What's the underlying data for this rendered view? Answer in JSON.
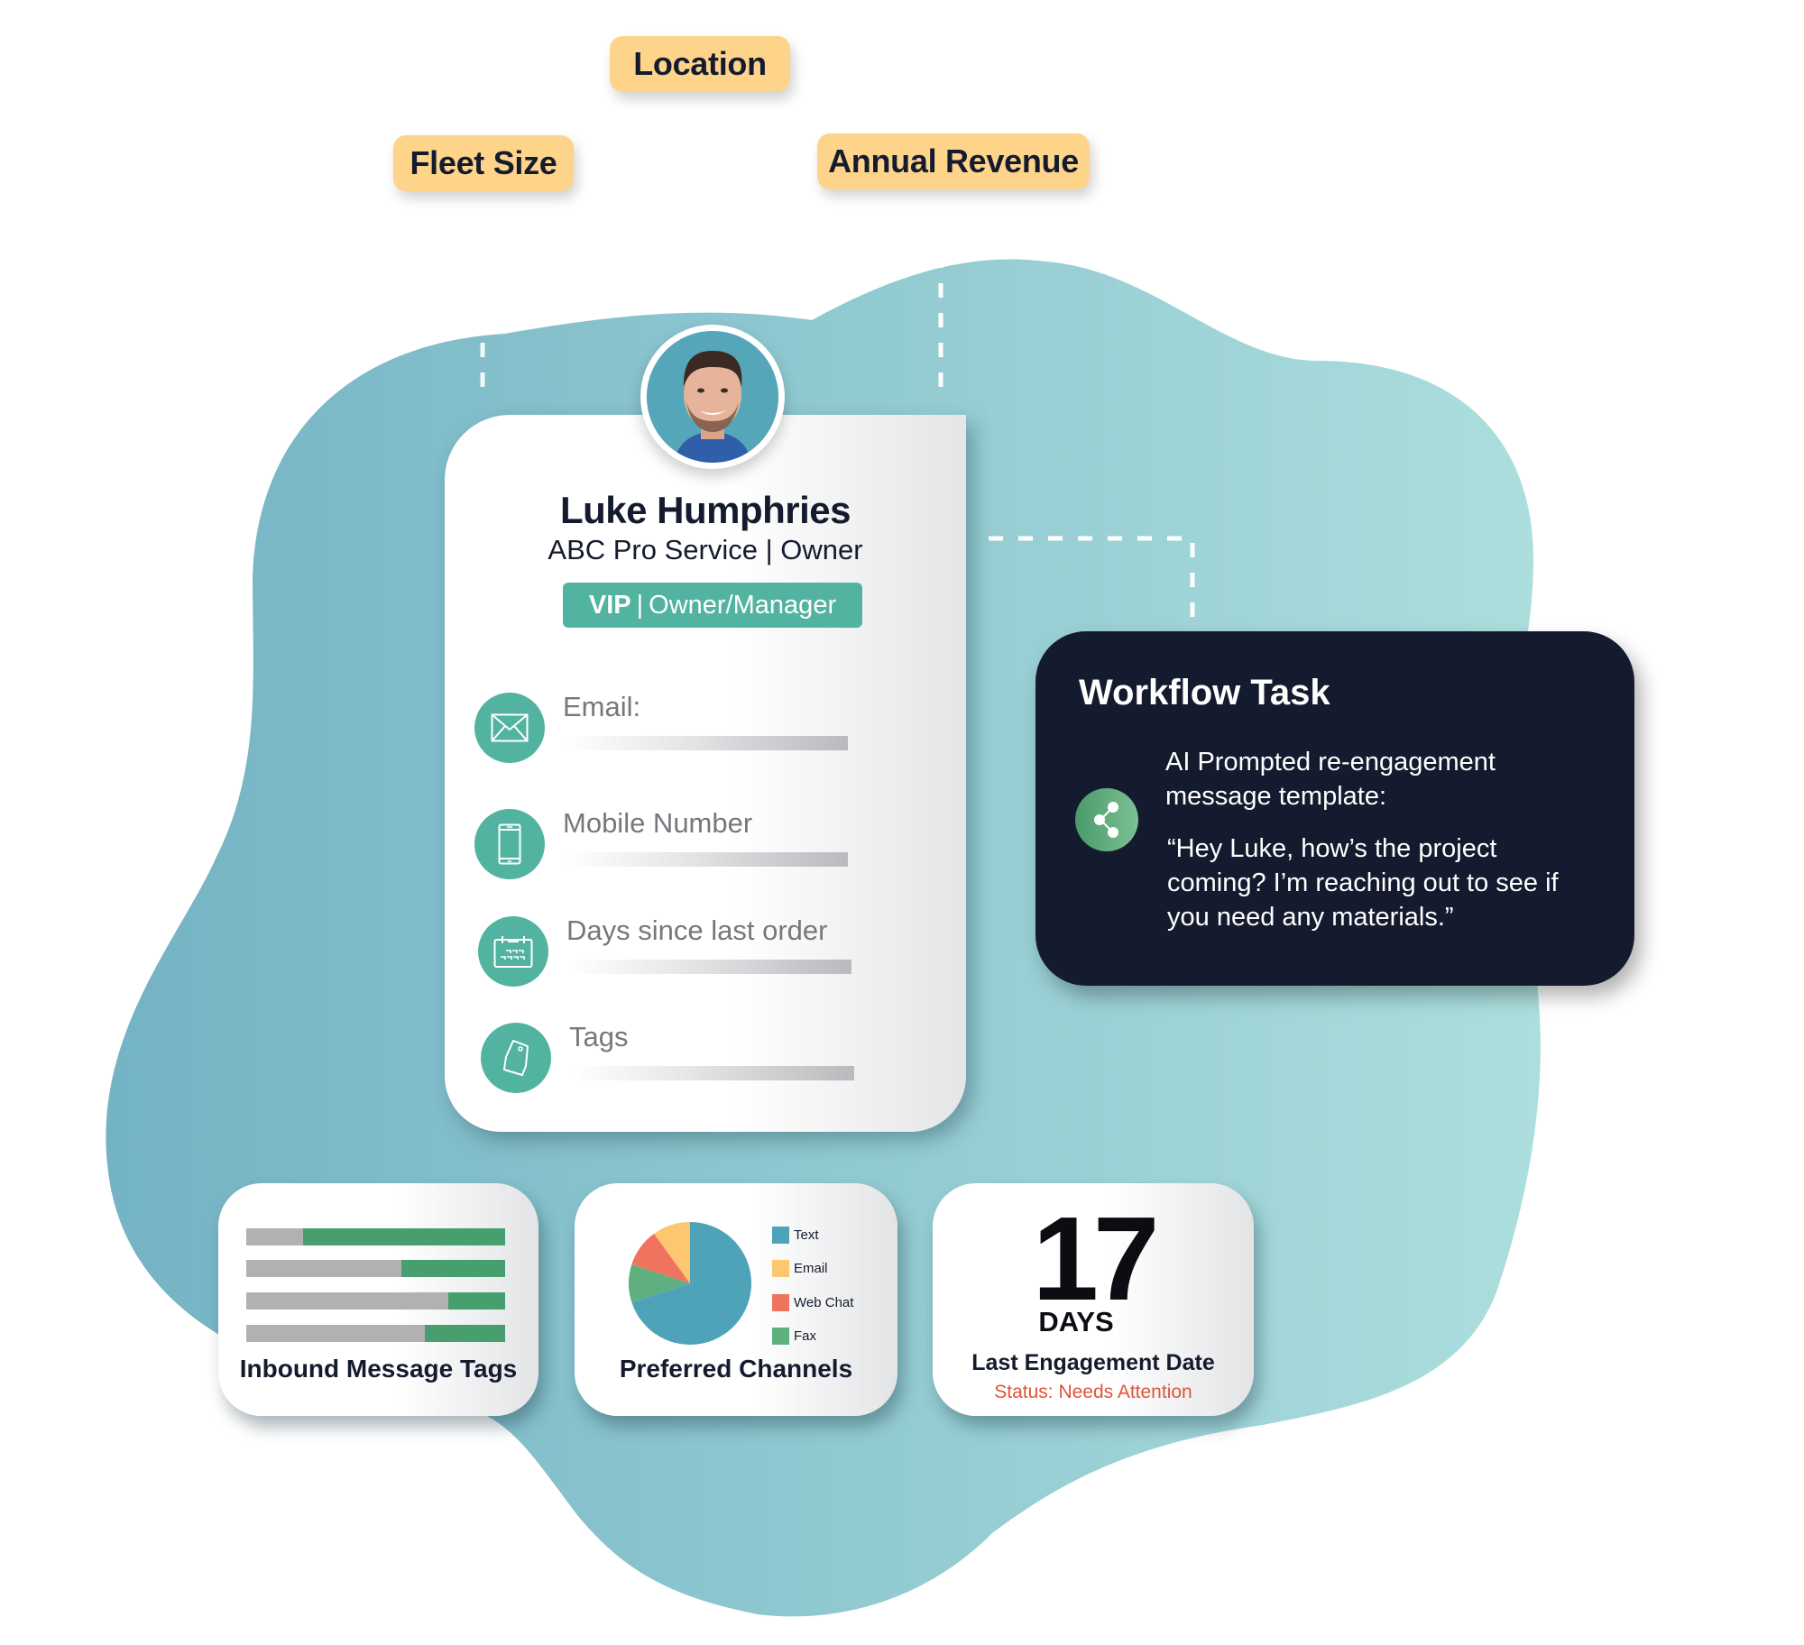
{
  "colors": {
    "blob_left": "#74b3c4",
    "blob_right": "#acdedd",
    "tag_pill": "#fdd48a",
    "teal_accent": "#52b4a0",
    "dark_navy": "#151b2e",
    "status_red": "#e0533b",
    "bar_gray": "#b0b1b0",
    "bar_green": "#479e6e"
  },
  "attribute_tags": [
    {
      "label": "Fleet Size"
    },
    {
      "label": "Location"
    },
    {
      "label": "Annual Revenue"
    }
  ],
  "profile": {
    "name": "Luke Humphries",
    "company": "ABC Pro Service",
    "role": "Owner",
    "subtitle": "ABC Pro Service | Owner",
    "badge_primary": "VIP",
    "badge_separator": "|",
    "badge_secondary": "Owner/Manager",
    "fields": [
      {
        "label": "Email:",
        "icon": "envelope-icon"
      },
      {
        "label": "Mobile Number",
        "icon": "mobile-phone-icon"
      },
      {
        "label": "Days since last order",
        "icon": "calendar-icon"
      },
      {
        "label": "Tags",
        "icon": "tag-icon"
      }
    ]
  },
  "workflow": {
    "title": "Workflow Task",
    "description": "AI Prompted re-engagement message template:",
    "message": "“Hey Luke, how’s the project coming? I’m reaching out to see if you need any materials.”",
    "icon": "share-icon"
  },
  "widgets": {
    "inbound_tags": {
      "title": "Inbound Message Tags",
      "bars": [
        {
          "gray_fraction": 0.22,
          "green_fraction": 0.78
        },
        {
          "gray_fraction": 0.6,
          "green_fraction": 0.4
        },
        {
          "gray_fraction": 0.78,
          "green_fraction": 0.22
        },
        {
          "gray_fraction": 0.69,
          "green_fraction": 0.31
        }
      ]
    },
    "preferred_channels": {
      "title": "Preferred Channels"
    },
    "engagement": {
      "number": "17",
      "unit": "DAYS",
      "title": "Last Engagement Date",
      "status": "Status: Needs Attention"
    }
  },
  "chart_data": {
    "type": "pie",
    "title": "Preferred Channels",
    "categories": [
      "Text",
      "Email",
      "Web Chat",
      "Fax"
    ],
    "values": [
      70,
      10,
      10,
      10
    ],
    "colors": [
      "#4fa3b8",
      "#fcc76f",
      "#ef735f",
      "#5fb07e"
    ],
    "legend": "right"
  }
}
